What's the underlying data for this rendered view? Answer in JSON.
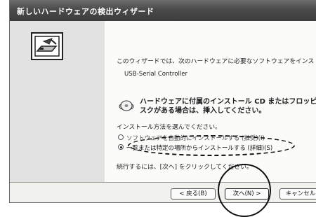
{
  "window": {
    "title": "新しいハードウェアの検出ウィザード"
  },
  "content": {
    "intro": "このウィザードでは、次のハードウェアに必要なソフトウェアをインストールします:",
    "device": "USB-Serial Controller",
    "cd_line1": "ハードウェアに付属のインストール CD またはフロッピー ディスク",
    "cd_line2": "スクがある場合は、挿入してください。",
    "choose": "インストール方法を選んでください。",
    "option1": "ソフトウェアを自動的にインストールする (推奨)(I)",
    "option2": "一覧または特定の場所からインストールする (詳細)(S)",
    "continue": "続行するには、[次へ] をクリックしてください。"
  },
  "buttons": {
    "back": "< 戻る(B)",
    "next": "次へ(N) >",
    "cancel": "キャンセル"
  },
  "icons": {
    "wizard": "hardware-wizard-icon",
    "cd": "cd-icon"
  }
}
